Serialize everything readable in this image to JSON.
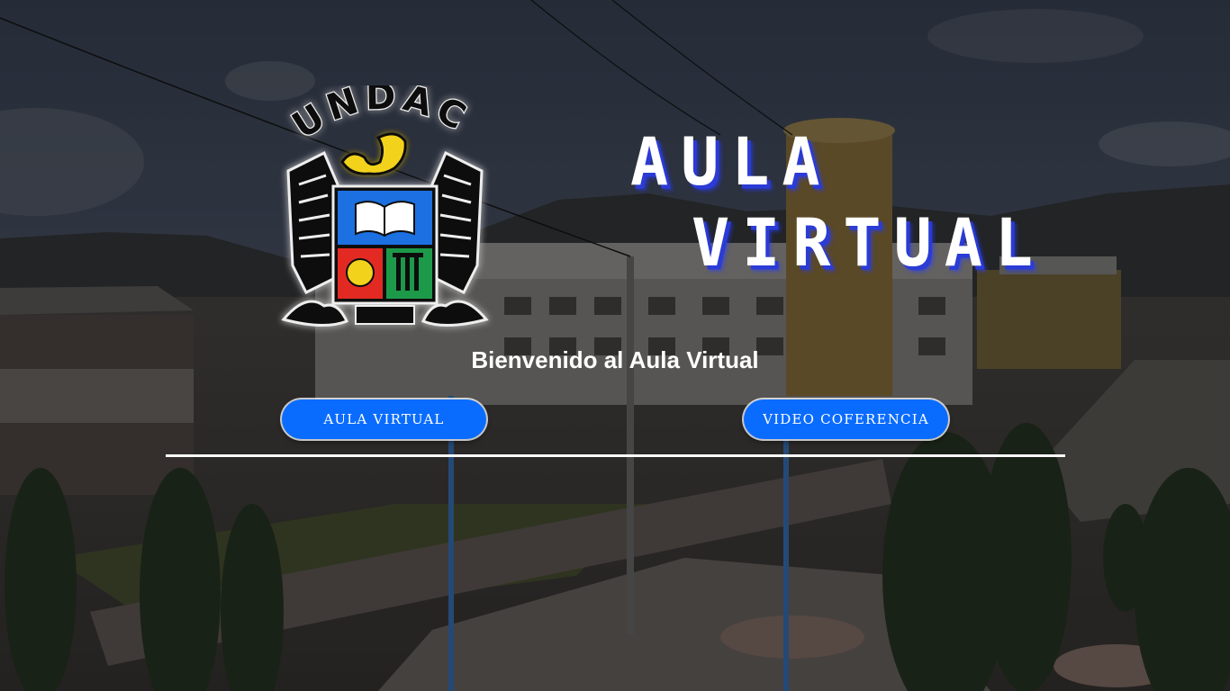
{
  "logo": {
    "text": "UNDAC"
  },
  "title": {
    "line1": "AULA",
    "line2": "VIRTUAL"
  },
  "welcome": "Bienvenido al Aula Virtual",
  "buttons": {
    "aula_virtual": "AULA VIRTUAL",
    "video_conferencia": "VIDEO COFERENCIA"
  },
  "colors": {
    "button_bg": "#0a6cff",
    "title_shadow": "#2a3bd6",
    "text": "#ffffff"
  }
}
